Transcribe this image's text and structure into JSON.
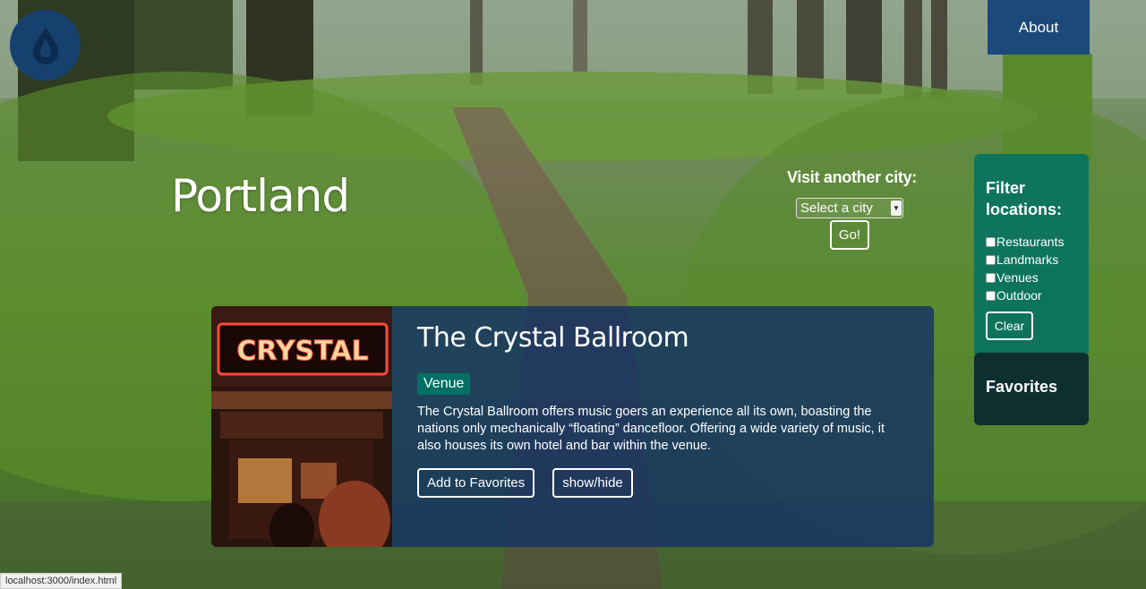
{
  "header": {
    "about_label": "About",
    "logo_icon": "water-drop-icon"
  },
  "city": {
    "name": "Portland"
  },
  "city_picker": {
    "label": "Visit another city:",
    "selected": "Select a city",
    "go_label": "Go!"
  },
  "filter": {
    "title": "Filter locations:",
    "options": [
      "Restaurants",
      "Landmarks",
      "Venues",
      "Outdoor"
    ],
    "clear_label": "Clear"
  },
  "favorites": {
    "title": "Favorites"
  },
  "card": {
    "title": "The Crystal Ballroom",
    "tag": "Venue",
    "sign_text": "CRYSTAL",
    "description": "The Crystal Ballroom offers music goers an experience all its own, boasting the nations only mechanically “floating” dancefloor. Offering a wide variety of music, it also houses its own hotel and bar within the venue.",
    "add_favorite_label": "Add to Favorites",
    "toggle_label": "show/hide"
  },
  "status_bar": {
    "url": "localhost:3000/index.html"
  },
  "colors": {
    "about_bg": "#1b4a7a",
    "logo_bg": "#16406e",
    "filter_bg": "#007064",
    "favorites_bg": "#0d2f30",
    "card_bg": "#14326e",
    "tag_bg": "#007064"
  }
}
